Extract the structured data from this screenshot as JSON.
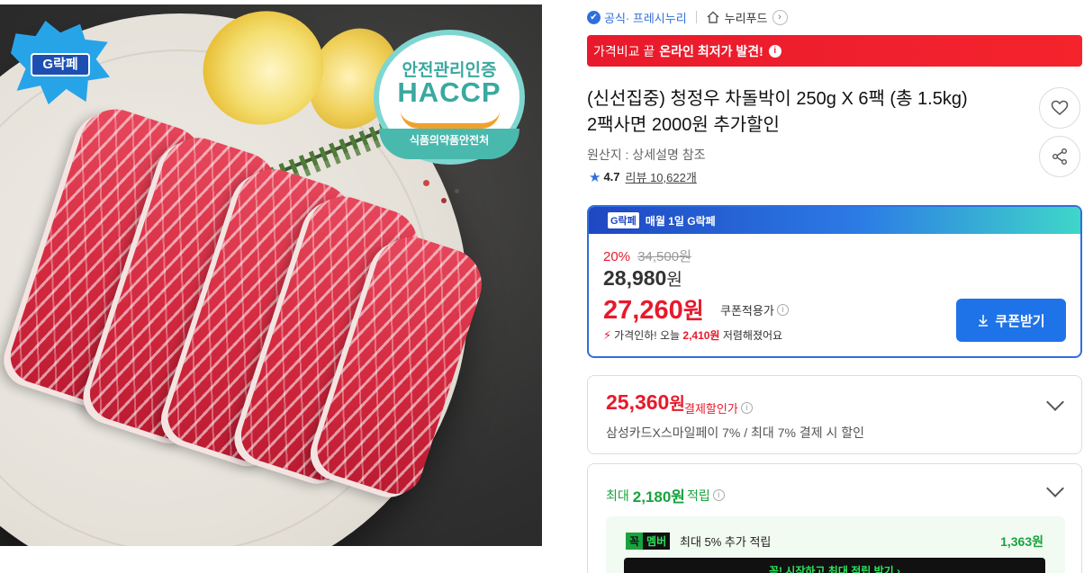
{
  "image": {
    "badge_label": "G락페",
    "certification": {
      "top_text": "안전관리인증",
      "main_text": "HACCP",
      "band_text": "식품의약품안전처"
    }
  },
  "seller": {
    "official_label": "공식",
    "official_name": "· 프레시누리",
    "brand_name": "누리푸드"
  },
  "banner": {
    "prefix": "가격비교 끝",
    "highlight": "온라인 최저가 발견!"
  },
  "product": {
    "title_line1": "(신선집중) 청정우 차돌박이 250g X 6팩 (총 1.5kg)",
    "title_line2": "2팩사면 2000원 추가할인",
    "origin": "원산지 : 상세설명 참조",
    "rating": "4.7",
    "review_label": "리뷰",
    "review_count": "10,622개"
  },
  "coupon_box": {
    "header_badge": "G락페",
    "header_text": "매월 1일 G락페",
    "discount_pct": "20%",
    "original_price": "34,500원",
    "sale_price": "28,980",
    "sale_unit": "원",
    "coupon_price": "27,260",
    "coupon_unit": "원",
    "coupon_note": "쿠폰적용가",
    "drop_prefix": "가격인하! 오늘",
    "drop_amount": "2,410원",
    "drop_suffix": "저렴해졌어요",
    "button_label": "쿠폰받기"
  },
  "card_discount": {
    "price": "25,360",
    "unit": "원",
    "tag": "결제할인가",
    "desc": "삼성카드X스마일페이 7% / 최대 7% 결제 시 할인"
  },
  "points": {
    "prefix": "최대",
    "amount": "2,180원",
    "suffix": "적립",
    "member_badge_a": "꼭",
    "member_badge_b": "멤버",
    "member_text": "최대 5% 추가 적립",
    "member_value": "1,363원",
    "member_cta": "꼭! 시작하고 최대 적립 받기 ›"
  },
  "colors": {
    "accent_red": "#e8192b",
    "accent_blue": "#2f6fdd",
    "accent_green": "#18a33f"
  }
}
